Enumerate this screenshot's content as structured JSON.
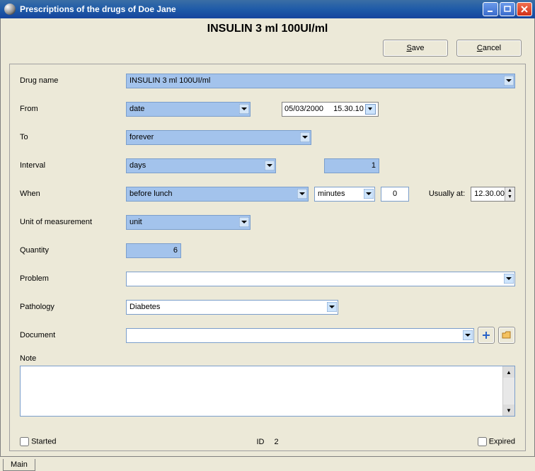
{
  "window": {
    "title": "Prescriptions of the drugs of Doe Jane"
  },
  "header": {
    "title": "INSULIN 3 ml 100UI/ml"
  },
  "buttons": {
    "save": "Save",
    "cancel": "Cancel"
  },
  "labels": {
    "drug_name": "Drug name",
    "from": "From",
    "to": "To",
    "interval": "Interval",
    "when": "When",
    "usually_at": "Usually at:",
    "unit": "Unit of measurement",
    "quantity": "Quantity",
    "problem": "Problem",
    "pathology": "Pathology",
    "document": "Document",
    "note": "Note",
    "started": "Started",
    "id": "ID",
    "expired": "Expired"
  },
  "fields": {
    "drug_name": "INSULIN 3 ml 100UI/ml",
    "from_mode": "date",
    "from_date": "05/03/2000",
    "from_time": "15.30.10",
    "to_mode": "forever",
    "interval_unit": "days",
    "interval_value": "1",
    "when_mode": "before lunch",
    "when_unit": "minutes",
    "when_value": "0",
    "usually_at": "12.30.00",
    "unit": "unit",
    "quantity": "6",
    "problem": "",
    "pathology": "Diabetes",
    "document": "",
    "note": "",
    "started_checked": false,
    "id_value": "2",
    "expired_checked": false
  },
  "tabs": {
    "main": "Main"
  }
}
